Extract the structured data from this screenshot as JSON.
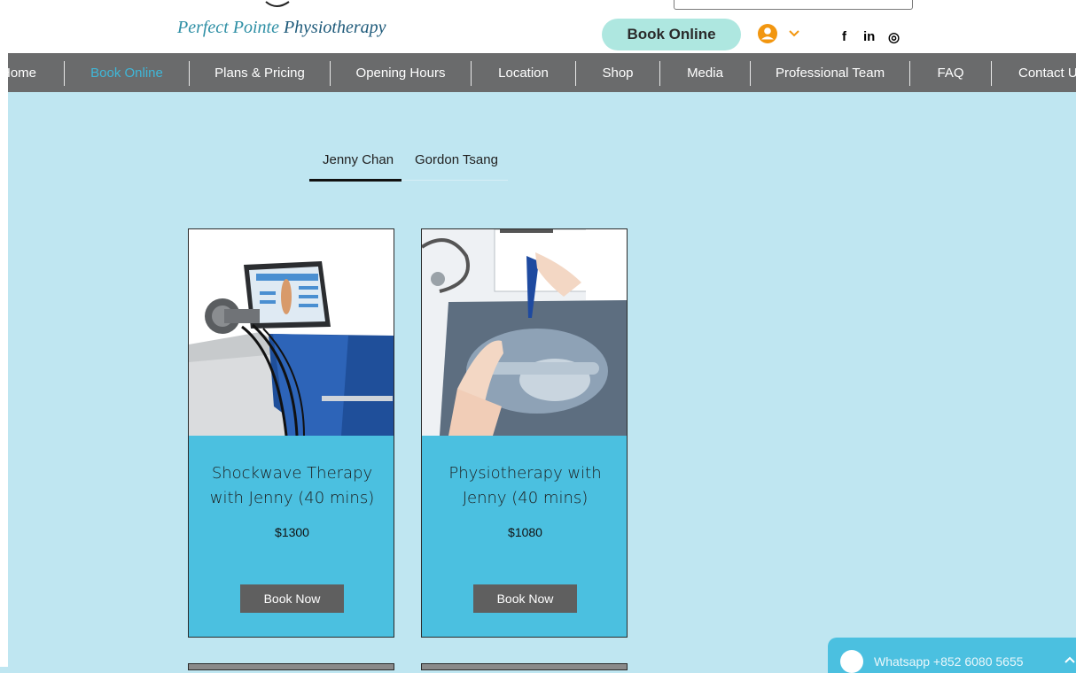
{
  "header": {
    "logo_text_1": "Perfect Pointe",
    "logo_text_2": "Physiotherapy",
    "book_online_label": "Book Online",
    "social": [
      {
        "icon": "facebook-icon",
        "label": "f"
      },
      {
        "icon": "linkedin-icon",
        "label": "in"
      },
      {
        "icon": "instagram-icon",
        "label": "◎"
      }
    ]
  },
  "nav": {
    "items": [
      {
        "label": "Home"
      },
      {
        "label": "Book Online"
      },
      {
        "label": "Plans & Pricing"
      },
      {
        "label": "Opening Hours"
      },
      {
        "label": "Location"
      },
      {
        "label": "Shop"
      },
      {
        "label": "Media"
      },
      {
        "label": "Professional Team"
      },
      {
        "label": "FAQ"
      },
      {
        "label": "Contact Us"
      }
    ],
    "active": "Book Online"
  },
  "tabs": [
    {
      "label": "Jenny Chan"
    },
    {
      "label": "Gordon Tsang"
    }
  ],
  "services": [
    {
      "title_line1": "Shockwave Therapy",
      "title_line2": "with Jenny (40 mins)",
      "price": "$1300",
      "button": "Book Now"
    },
    {
      "title_line1": "Physiotherapy with",
      "title_line2": "Jenny (40 mins)",
      "price": "$1080",
      "button": "Book Now"
    }
  ],
  "whatsapp": {
    "label": "Whatsapp +852 6080 5655"
  },
  "colors": {
    "background": "#bfe6f1",
    "nav": "#6a6b6c",
    "accent": "#3fb7d8",
    "card": "#4bc0e0",
    "book_online_pill": "#aee7e0",
    "user_icon": "#f2960f"
  }
}
